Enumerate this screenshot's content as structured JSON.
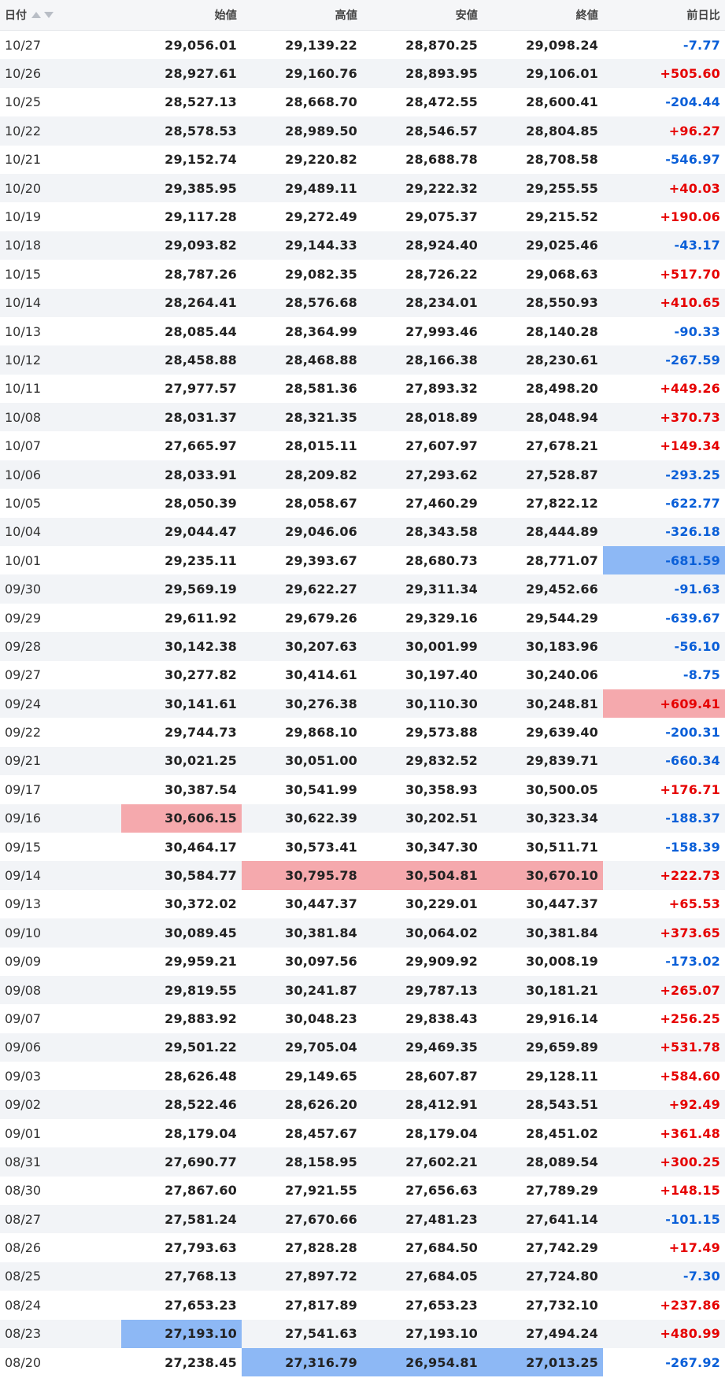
{
  "colors": {
    "positive": "#e60000",
    "negative": "#0a5fd8",
    "highlight_high": "#f5a9ad",
    "highlight_low": "#8db8f5"
  },
  "headers": {
    "date": "日付",
    "open": "始値",
    "high": "高値",
    "low": "安値",
    "close": "終値",
    "change": "前日比"
  },
  "sort_icons": [
    "sort-ascending-icon",
    "sort-descending-icon"
  ],
  "rows": [
    {
      "date": "10/27",
      "open": "29,056.01",
      "high": "29,139.22",
      "low": "28,870.25",
      "close": "29,098.24",
      "change": "-7.77"
    },
    {
      "date": "10/26",
      "open": "28,927.61",
      "high": "29,160.76",
      "low": "28,893.95",
      "close": "29,106.01",
      "change": "+505.60"
    },
    {
      "date": "10/25",
      "open": "28,527.13",
      "high": "28,668.70",
      "low": "28,472.55",
      "close": "28,600.41",
      "change": "-204.44"
    },
    {
      "date": "10/22",
      "open": "28,578.53",
      "high": "28,989.50",
      "low": "28,546.57",
      "close": "28,804.85",
      "change": "+96.27"
    },
    {
      "date": "10/21",
      "open": "29,152.74",
      "high": "29,220.82",
      "low": "28,688.78",
      "close": "28,708.58",
      "change": "-546.97"
    },
    {
      "date": "10/20",
      "open": "29,385.95",
      "high": "29,489.11",
      "low": "29,222.32",
      "close": "29,255.55",
      "change": "+40.03"
    },
    {
      "date": "10/19",
      "open": "29,117.28",
      "high": "29,272.49",
      "low": "29,075.37",
      "close": "29,215.52",
      "change": "+190.06"
    },
    {
      "date": "10/18",
      "open": "29,093.82",
      "high": "29,144.33",
      "low": "28,924.40",
      "close": "29,025.46",
      "change": "-43.17"
    },
    {
      "date": "10/15",
      "open": "28,787.26",
      "high": "29,082.35",
      "low": "28,726.22",
      "close": "29,068.63",
      "change": "+517.70"
    },
    {
      "date": "10/14",
      "open": "28,264.41",
      "high": "28,576.68",
      "low": "28,234.01",
      "close": "28,550.93",
      "change": "+410.65"
    },
    {
      "date": "10/13",
      "open": "28,085.44",
      "high": "28,364.99",
      "low": "27,993.46",
      "close": "28,140.28",
      "change": "-90.33"
    },
    {
      "date": "10/12",
      "open": "28,458.88",
      "high": "28,468.88",
      "low": "28,166.38",
      "close": "28,230.61",
      "change": "-267.59"
    },
    {
      "date": "10/11",
      "open": "27,977.57",
      "high": "28,581.36",
      "low": "27,893.32",
      "close": "28,498.20",
      "change": "+449.26"
    },
    {
      "date": "10/08",
      "open": "28,031.37",
      "high": "28,321.35",
      "low": "28,018.89",
      "close": "28,048.94",
      "change": "+370.73"
    },
    {
      "date": "10/07",
      "open": "27,665.97",
      "high": "28,015.11",
      "low": "27,607.97",
      "close": "27,678.21",
      "change": "+149.34"
    },
    {
      "date": "10/06",
      "open": "28,033.91",
      "high": "28,209.82",
      "low": "27,293.62",
      "close": "27,528.87",
      "change": "-293.25"
    },
    {
      "date": "10/05",
      "open": "28,050.39",
      "high": "28,058.67",
      "low": "27,460.29",
      "close": "27,822.12",
      "change": "-622.77"
    },
    {
      "date": "10/04",
      "open": "29,044.47",
      "high": "29,046.06",
      "low": "28,343.58",
      "close": "28,444.89",
      "change": "-326.18"
    },
    {
      "date": "10/01",
      "open": "29,235.11",
      "high": "29,393.67",
      "low": "28,680.73",
      "close": "28,771.07",
      "change": "-681.59",
      "hl": {
        "change": "blue"
      }
    },
    {
      "date": "09/30",
      "open": "29,569.19",
      "high": "29,622.27",
      "low": "29,311.34",
      "close": "29,452.66",
      "change": "-91.63"
    },
    {
      "date": "09/29",
      "open": "29,611.92",
      "high": "29,679.26",
      "low": "29,329.16",
      "close": "29,544.29",
      "change": "-639.67"
    },
    {
      "date": "09/28",
      "open": "30,142.38",
      "high": "30,207.63",
      "low": "30,001.99",
      "close": "30,183.96",
      "change": "-56.10"
    },
    {
      "date": "09/27",
      "open": "30,277.82",
      "high": "30,414.61",
      "low": "30,197.40",
      "close": "30,240.06",
      "change": "-8.75"
    },
    {
      "date": "09/24",
      "open": "30,141.61",
      "high": "30,276.38",
      "low": "30,110.30",
      "close": "30,248.81",
      "change": "+609.41",
      "hl": {
        "change": "red"
      }
    },
    {
      "date": "09/22",
      "open": "29,744.73",
      "high": "29,868.10",
      "low": "29,573.88",
      "close": "29,639.40",
      "change": "-200.31"
    },
    {
      "date": "09/21",
      "open": "30,021.25",
      "high": "30,051.00",
      "low": "29,832.52",
      "close": "29,839.71",
      "change": "-660.34"
    },
    {
      "date": "09/17",
      "open": "30,387.54",
      "high": "30,541.99",
      "low": "30,358.93",
      "close": "30,500.05",
      "change": "+176.71"
    },
    {
      "date": "09/16",
      "open": "30,606.15",
      "high": "30,622.39",
      "low": "30,202.51",
      "close": "30,323.34",
      "change": "-188.37",
      "hl": {
        "open": "red"
      }
    },
    {
      "date": "09/15",
      "open": "30,464.17",
      "high": "30,573.41",
      "low": "30,347.30",
      "close": "30,511.71",
      "change": "-158.39"
    },
    {
      "date": "09/14",
      "open": "30,584.77",
      "high": "30,795.78",
      "low": "30,504.81",
      "close": "30,670.10",
      "change": "+222.73",
      "hl": {
        "high": "red",
        "low": "red",
        "close": "red"
      }
    },
    {
      "date": "09/13",
      "open": "30,372.02",
      "high": "30,447.37",
      "low": "30,229.01",
      "close": "30,447.37",
      "change": "+65.53"
    },
    {
      "date": "09/10",
      "open": "30,089.45",
      "high": "30,381.84",
      "low": "30,064.02",
      "close": "30,381.84",
      "change": "+373.65"
    },
    {
      "date": "09/09",
      "open": "29,959.21",
      "high": "30,097.56",
      "low": "29,909.92",
      "close": "30,008.19",
      "change": "-173.02"
    },
    {
      "date": "09/08",
      "open": "29,819.55",
      "high": "30,241.87",
      "low": "29,787.13",
      "close": "30,181.21",
      "change": "+265.07"
    },
    {
      "date": "09/07",
      "open": "29,883.92",
      "high": "30,048.23",
      "low": "29,838.43",
      "close": "29,916.14",
      "change": "+256.25"
    },
    {
      "date": "09/06",
      "open": "29,501.22",
      "high": "29,705.04",
      "low": "29,469.35",
      "close": "29,659.89",
      "change": "+531.78"
    },
    {
      "date": "09/03",
      "open": "28,626.48",
      "high": "29,149.65",
      "low": "28,607.87",
      "close": "29,128.11",
      "change": "+584.60"
    },
    {
      "date": "09/02",
      "open": "28,522.46",
      "high": "28,626.20",
      "low": "28,412.91",
      "close": "28,543.51",
      "change": "+92.49"
    },
    {
      "date": "09/01",
      "open": "28,179.04",
      "high": "28,457.67",
      "low": "28,179.04",
      "close": "28,451.02",
      "change": "+361.48"
    },
    {
      "date": "08/31",
      "open": "27,690.77",
      "high": "28,158.95",
      "low": "27,602.21",
      "close": "28,089.54",
      "change": "+300.25"
    },
    {
      "date": "08/30",
      "open": "27,867.60",
      "high": "27,921.55",
      "low": "27,656.63",
      "close": "27,789.29",
      "change": "+148.15"
    },
    {
      "date": "08/27",
      "open": "27,581.24",
      "high": "27,670.66",
      "low": "27,481.23",
      "close": "27,641.14",
      "change": "-101.15"
    },
    {
      "date": "08/26",
      "open": "27,793.63",
      "high": "27,828.28",
      "low": "27,684.50",
      "close": "27,742.29",
      "change": "+17.49"
    },
    {
      "date": "08/25",
      "open": "27,768.13",
      "high": "27,897.72",
      "low": "27,684.05",
      "close": "27,724.80",
      "change": "-7.30"
    },
    {
      "date": "08/24",
      "open": "27,653.23",
      "high": "27,817.89",
      "low": "27,653.23",
      "close": "27,732.10",
      "change": "+237.86"
    },
    {
      "date": "08/23",
      "open": "27,193.10",
      "high": "27,541.63",
      "low": "27,193.10",
      "close": "27,494.24",
      "change": "+480.99",
      "hl": {
        "open": "blue"
      }
    },
    {
      "date": "08/20",
      "open": "27,238.45",
      "high": "27,316.79",
      "low": "26,954.81",
      "close": "27,013.25",
      "change": "-267.92",
      "hl": {
        "high": "blue",
        "low": "blue",
        "close": "blue"
      }
    }
  ]
}
